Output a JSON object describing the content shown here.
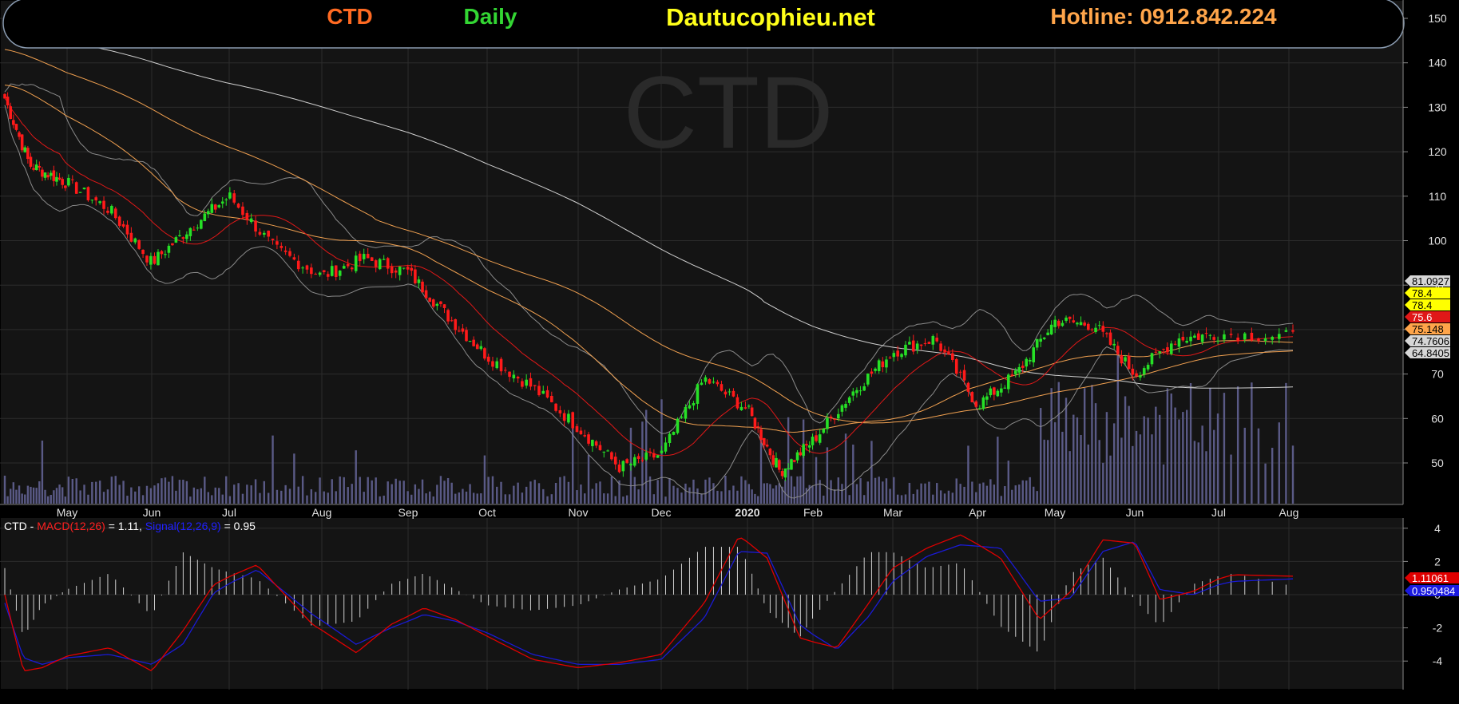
{
  "header": {
    "ticker": "CTD",
    "interval": "Daily",
    "site": "Dautucophieu.net",
    "hotline": "Hotline: 0912.842.224"
  },
  "watermark": "CTD",
  "colors": {
    "background": "#000000",
    "panel": "#141414",
    "ticker": "#ff6a22",
    "interval": "#33d633",
    "site": "#ffff1a",
    "hotline": "#ffa54a",
    "up_candle": "#26e026",
    "down_candle": "#ff1a1a",
    "ma_white": "#cfcfcf",
    "ma_orange": "#f0a050",
    "ma_red": "#e01818",
    "bollinger": "#8a8a8a",
    "volume": "#5a5a86",
    "macd": "#e00000",
    "signal": "#1a1ad6",
    "histogram": "#d0d0d0"
  },
  "chart_data": [
    {
      "type": "candlestick",
      "x_tick_labels": [
        "May",
        "Jun",
        "Jul",
        "Aug",
        "Sep",
        "Oct",
        "Nov",
        "Dec",
        "2020",
        "Feb",
        "Mar",
        "Apr",
        "May",
        "Jun",
        "Jul",
        "Aug"
      ],
      "y_tick_labels": [
        "150",
        "140",
        "130",
        "120",
        "110",
        "100",
        "90",
        "80",
        "70",
        "60",
        "50"
      ],
      "ylim": [
        41,
        151
      ],
      "grid": true,
      "close_profile": {
        "note_units": "price",
        "x_month_index": [
          0,
          0.4,
          1.0,
          1.5,
          2.0,
          2.5,
          3.0,
          3.5,
          4.0,
          4.5,
          5.0,
          5.5,
          6.0,
          6.5,
          7.0,
          7.5,
          8.0,
          8.5,
          9.0,
          9.5,
          10.0,
          10.5,
          11.0,
          11.5,
          12.0,
          12.5,
          13.0,
          13.5,
          14.0,
          14.5,
          15.0,
          15.5
        ],
        "close": [
          132,
          117,
          113,
          107,
          95,
          103,
          110,
          98,
          92,
          96,
          93,
          83,
          74,
          67,
          58,
          49,
          52,
          69,
          62,
          48,
          55,
          66,
          75,
          78,
          63,
          70,
          82,
          81,
          70,
          78,
          79,
          78.4
        ]
      },
      "last_values": {
        "bollinger_upper": "81.0927",
        "close": "78.4",
        "close_label": "78.4",
        "ma_red": "75.6",
        "ma_orange": "75.148",
        "ma_white": "74.7606",
        "bollinger_lower": "64.8405"
      },
      "series": [
        {
          "name": "MA white",
          "start": 147,
          "end": 65
        },
        {
          "name": "MA orange slow",
          "start": 143,
          "end": 70
        },
        {
          "name": "MA orange fast",
          "start": 135,
          "end": 75
        },
        {
          "name": "MA red",
          "start": 130,
          "end": 76
        }
      ],
      "volume": true
    },
    {
      "type": "line",
      "title": "CTD - MACD(12,26) = 1.11, Signal(12,26,9) = 0.95",
      "label_prefix": "CTD - ",
      "label_macd": "MACD(12,26)",
      "label_macd_value": " = 1.11, ",
      "label_signal": "Signal(12,26,9)",
      "label_signal_value": " = 0.95",
      "y_tick_labels": [
        "4",
        "2",
        "0",
        "-2",
        "-4"
      ],
      "ylim": [
        -5.3,
        5.3
      ],
      "macd_profile": {
        "x_month_index": [
          0,
          0.3,
          0.6,
          1.0,
          1.5,
          2.0,
          2.4,
          2.8,
          3.3,
          3.9,
          4.4,
          4.8,
          5.2,
          5.6,
          6.0,
          6.5,
          7.0,
          7.5,
          8.0,
          8.5,
          8.9,
          9.3,
          9.8,
          10.3,
          10.7,
          11.0,
          11.4,
          11.8,
          12.3,
          12.8,
          13.2,
          13.6,
          14.0,
          14.3,
          14.7,
          15.1,
          15.5
        ],
        "macd": [
          0,
          -4.6,
          -4.4,
          -3.7,
          -3.2,
          -4.6,
          -2.2,
          0.6,
          1.8,
          -1.8,
          -3.5,
          -1.8,
          -0.8,
          -1.5,
          -2.5,
          -3.9,
          -4.4,
          -4.1,
          -3.6,
          -0.5,
          3.5,
          2.2,
          -2.6,
          -3.2,
          -0.5,
          1.6,
          2.8,
          3.6,
          2.2,
          -1.5,
          0.2,
          3.3,
          3.1,
          -0.3,
          0.2,
          1.2,
          1.11
        ],
        "signal": [
          -0.5,
          -3.8,
          -4.2,
          -3.8,
          -3.6,
          -4.2,
          -3.0,
          0.1,
          1.5,
          -1.2,
          -3.0,
          -2.0,
          -1.2,
          -1.6,
          -2.3,
          -3.6,
          -4.2,
          -4.2,
          -3.9,
          -1.4,
          2.6,
          2.5,
          -1.8,
          -3.3,
          -1.3,
          0.8,
          2.3,
          3.0,
          2.8,
          -0.4,
          -0.2,
          2.6,
          3.2,
          0.3,
          0.0,
          0.8,
          0.95
        ]
      },
      "last_values": {
        "macd": "1.11061",
        "signal": "0.950484"
      }
    }
  ]
}
